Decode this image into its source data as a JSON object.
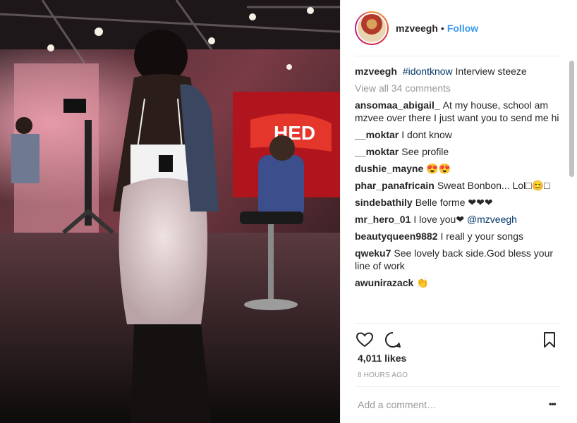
{
  "post": {
    "username": "mzveegh",
    "follow_label": "Follow",
    "dot": "•",
    "avatar_text": "mzvee",
    "caption": {
      "user": "mzveegh",
      "hashtag": "#idontknow",
      "text": "Interview steeze"
    },
    "view_all": "View all 34 comments",
    "comments": [
      {
        "user": "ansomaa_abigail_",
        "text": "At my house, school am mzvee over there I just want you to send me hi"
      },
      {
        "user": "__moktar",
        "text": "I dont know"
      },
      {
        "user": "__moktar",
        "text": "See profile"
      },
      {
        "user": "dushie_mayne",
        "text": "😍😍"
      },
      {
        "user": "phar_panafricain",
        "text": "Sweat Bonbon... Lol□😊□"
      },
      {
        "user": "sindebathily",
        "text": "Belle forme ❤❤❤"
      },
      {
        "user": "mr_hero_01",
        "text": "I love you❤",
        "mention": "@mzveegh"
      },
      {
        "user": "beautyqueen9882",
        "text": "I reall y your songs"
      },
      {
        "user": "qweku7",
        "text": "See lovely back side.God bless your line of work"
      },
      {
        "user": "awunirazack",
        "text": "👏"
      }
    ],
    "likes": "4,011 likes",
    "time": "8 HOURS AGO",
    "add_comment_placeholder": "Add a comment…",
    "more_label": "•••",
    "icons": {
      "like": "heart-icon",
      "comment": "comment-bubble-icon",
      "save": "bookmark-icon",
      "more": "more-dots-icon"
    },
    "colors": {
      "link": "#3897f0",
      "muted": "#999999",
      "text": "#262626",
      "divider": "#efefef"
    }
  }
}
